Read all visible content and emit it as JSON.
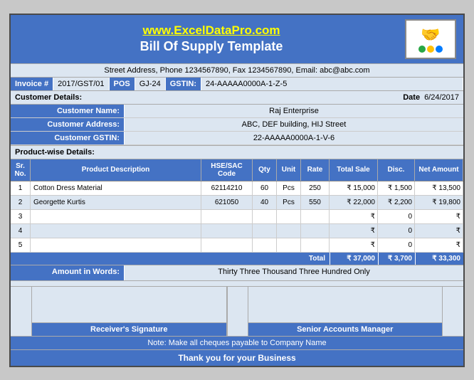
{
  "header": {
    "url": "www.ExcelDataPro.com",
    "title": "Bill Of Supply Template"
  },
  "address_bar": "Street Address, Phone 1234567890, Fax 1234567890, Email: abc@abc.com",
  "invoice": {
    "label": "Invoice #",
    "number": "2017/GST/01",
    "pos_label": "POS",
    "pos_value": "GJ-24",
    "gstin_label": "GSTIN:",
    "gstin_value": "24-AAAAA0000A-1-Z-5",
    "date_label": "Date",
    "date_value": "6/24/2017"
  },
  "customer": {
    "section_label": "Customer Details:",
    "name_label": "Customer Name:",
    "name_value": "Raj Enterprise",
    "address_label": "Customer Address:",
    "address_value": "ABC, DEF building, HIJ Street",
    "gstin_label": "Customer GSTIN:",
    "gstin_value": "22-AAAAA0000A-1-V-6"
  },
  "product_section_label": "Product-wise Details:",
  "table": {
    "headers": {
      "sr": "Sr. No.",
      "desc": "Product Description",
      "hse": "HSE/SAC Code",
      "qty": "Qty",
      "unit": "Unit",
      "rate": "Rate",
      "total_sale": "Total Sale",
      "disc": "Disc.",
      "net_amount": "Net Amount"
    },
    "rows": [
      {
        "sr": "1",
        "desc": "Cotton Dress Material",
        "hse": "62114210",
        "qty": "60",
        "unit": "Pcs",
        "rate": "250",
        "total_sale": "₹  15,000",
        "disc": "₹  1,500",
        "net": "₹  13,500"
      },
      {
        "sr": "2",
        "desc": "Georgette Kurtis",
        "hse": "621050",
        "qty": "40",
        "unit": "Pcs",
        "rate": "550",
        "total_sale": "₹  22,000",
        "disc": "₹  2,200",
        "net": "₹  19,800"
      },
      {
        "sr": "3",
        "desc": "",
        "hse": "",
        "qty": "",
        "unit": "",
        "rate": "",
        "total_sale": "₹",
        "disc": "0",
        "net": "₹"
      },
      {
        "sr": "4",
        "desc": "",
        "hse": "",
        "qty": "",
        "unit": "",
        "rate": "",
        "total_sale": "₹",
        "disc": "0",
        "net": "₹"
      },
      {
        "sr": "5",
        "desc": "",
        "hse": "",
        "qty": "",
        "unit": "",
        "rate": "",
        "total_sale": "₹",
        "disc": "0",
        "net": "₹"
      }
    ],
    "total_label": "Total",
    "total_sale": "₹  37,000",
    "total_disc": "₹  3,700",
    "total_net": "₹  33,300"
  },
  "amount_in_words": {
    "label": "Amount in Words:",
    "value": "Thirty Three Thousand Three Hundred Only"
  },
  "signatures": {
    "receiver": "Receiver's Signature",
    "accounts": "Senior Accounts Manager"
  },
  "note": "Note: Make all cheques payable to Company Name",
  "thankyou": "Thank you for your Business"
}
